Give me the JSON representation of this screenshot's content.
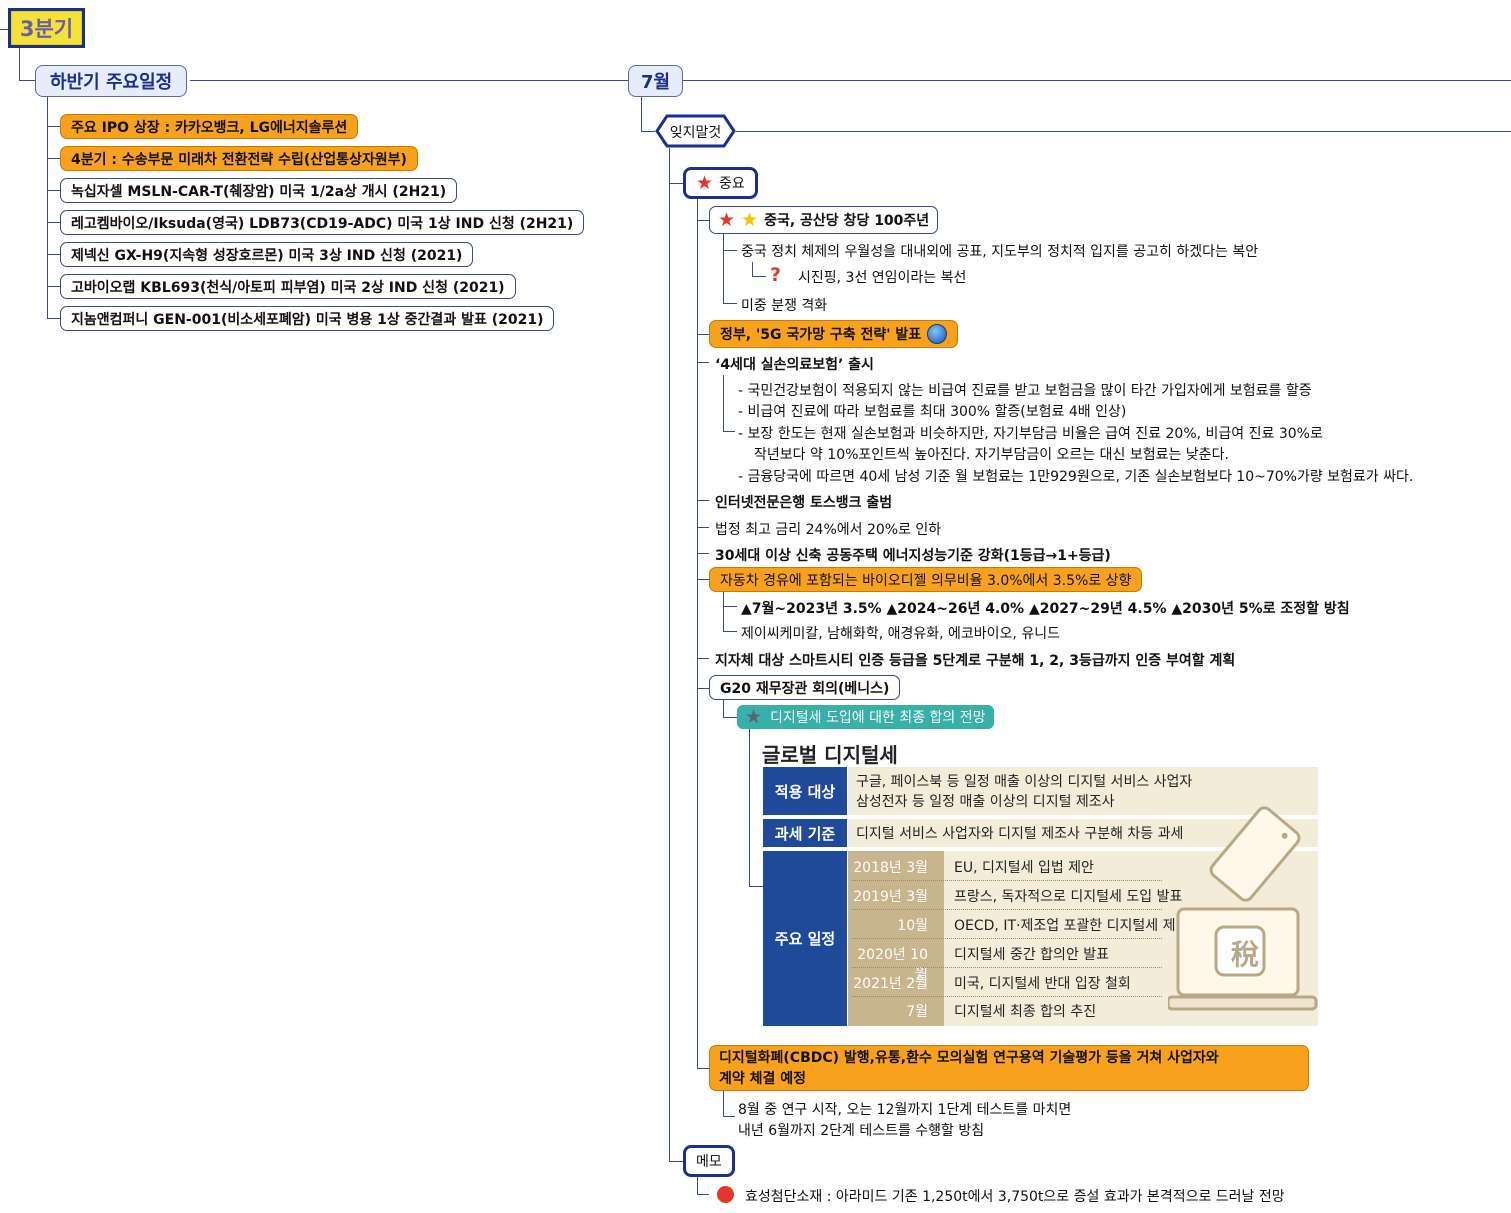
{
  "root": {
    "label": "3분기"
  },
  "left_branch": {
    "title": "하반기 주요일정",
    "items": [
      {
        "label": "주요 IPO 상장 : 카카오뱅크, LG에너지솔루션",
        "style": "orange"
      },
      {
        "label": "4분기 : 수송부문 미래차 전환전략 수립(산업통상자원부)",
        "style": "orange"
      },
      {
        "label": "녹십자셀 MSLN-CAR-T(췌장암) 미국 1/2a상 개시 (2H21)",
        "style": "outline"
      },
      {
        "label": "레고켐바이오/Iksuda(영국) LDB73(CD19-ADC) 미국 1상 IND 신청 (2H21)",
        "style": "outline"
      },
      {
        "label": "제넥신 GX-H9(지속형 성장호르몬) 미국 3상 IND 신청 (2021)",
        "style": "outline"
      },
      {
        "label": "고바이오랩 KBL693(천식/아토피 피부염) 미국 2상 IND 신청 (2021)",
        "style": "outline"
      },
      {
        "label": "지놈앤컴퍼니 GEN-001(비소세포폐암) 미국 병용 1상 중간결과 발표 (2021)",
        "style": "outline"
      }
    ]
  },
  "month": {
    "label": "7월"
  },
  "dont_forget": {
    "label": "잊지말것"
  },
  "important": {
    "label": "중요"
  },
  "items": {
    "china": {
      "label": "중국, 공산당 창당 100주년",
      "sub1": "중국 정치 체제의 우월성을 대내외에 공표, 지도부의 정치적 입지를 공고히 하겠다는 복안",
      "sub1a": "시진핑, 3선 연임이라는 복선",
      "sub2": "미중 분쟁 격화"
    },
    "g5": {
      "label": "정부, '5G 국가망 구축 전략' 발표"
    },
    "insurance": {
      "label": "‘4세대 실손의료보험’ 출시",
      "lines": [
        "- 국민건강보험이 적용되지 않는 비급여 진료를 받고 보험금을 많이 타간 가입자에게 보험료를 할증",
        "- 비급여 진료에 따라 보험료를 최대 300% 할증(보험료 4배 인상)",
        "- 보장 한도는 현재 실손보험과 비슷하지만, 자기부담금 비율은 급여 진료 20%, 비급여 진료 30%로",
        "작년보다 약 10%포인트씩 높아진다. 자기부담금이 오르는 대신 보험료는 낮춘다.",
        "- 금융당국에 따르면 40세 남성 기준 월 보험료는 1만929원으로, 기존 실손보험보다 10~70%가량 보험료가 싸다."
      ]
    },
    "toss": {
      "label": "인터넷전문은행 토스뱅크 출범"
    },
    "rate": {
      "label": "법정 최고 금리 24%에서 20%로 인하"
    },
    "energy": {
      "label": "30세대 이상 신축 공동주택 에너지성능기준 강화(1등급→1+등급)"
    },
    "biodiesel": {
      "label": "자동차 경유에 포함되는 바이오디젤 의무비율 3.0%에서 3.5%로 상향",
      "sub1": "▲7월~2023년 3.5% ▲2024~26년 4.0% ▲2027~29년 4.5% ▲2030년 5%로 조정할 방침",
      "sub2": "제이씨케미칼, 남해화학, 애경유화, 에코바이오, 유니드"
    },
    "smartcity": {
      "label": "지자체 대상 스마트시티 인증 등급을 5단계로 구분해 1, 2, 3등급까지 인증 부여할 계획"
    },
    "g20": {
      "label": "G20 재무장관 회의(베니스)",
      "sub": "디지털세 도입에 대한 최종 합의 전망"
    },
    "cbdc": {
      "label1": "디지털화폐(CBDC) 발행,유통,환수 모의실험 연구용역 기술평가 등을 거쳐 사업자와",
      "label2": "계약 체결 예정",
      "sub1": "8월 중 연구 시작, 오는 12월까지 1단계 테스트를 마치면",
      "sub2": "내년 6월까지 2단계 테스트를 수행할 방침"
    }
  },
  "digital_tax": {
    "title": "글로벌 디지털세",
    "target_label": "적용 대상",
    "target_text1": "구글, 페이스북 등 일정 매출 이상의 디지털 서비스 사업자",
    "target_text2": "삼성전자 등 일정 매출 이상의 디지털 제조사",
    "basis_label": "과세 기준",
    "basis_text": "디지털 서비스 사업자와 디지털 제조사 구분해 차등 과세",
    "schedule_label": "주요 일정",
    "schedule": [
      {
        "date": "2018년 3월",
        "event": "EU, 디지털세 입법 제안"
      },
      {
        "date": "2019년 3월",
        "event": "프랑스, 독자적으로 디지털세 도입 발표"
      },
      {
        "date": "10월",
        "event": "OECD, IT·제조업 포괄한 디지털세 제안"
      },
      {
        "date": "2020년 10월",
        "event": "디지털세 중간 합의안 발표"
      },
      {
        "date": "2021년 2월",
        "event": "미국, 디지털세 반대 입장 철회"
      },
      {
        "date": "7월",
        "event": "디지털세 최종 합의 추진"
      }
    ],
    "tax_char": "稅"
  },
  "memo": {
    "label": "메모",
    "item": "효성첨단소재 : 아라미드 기존 1,250t에서 3,750t으로 증설 효과가 본격적으로 드러날 전망"
  }
}
